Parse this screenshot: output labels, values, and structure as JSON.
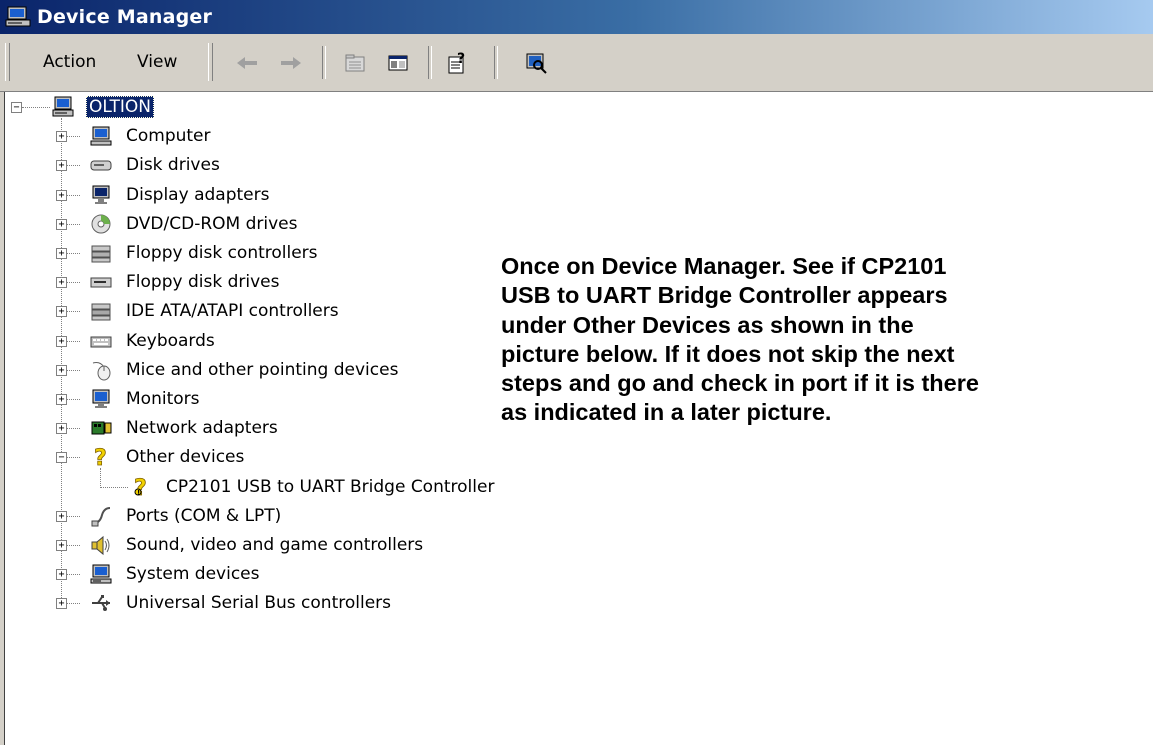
{
  "window": {
    "title": "Device Manager"
  },
  "menu": {
    "action": "Action",
    "view": "View"
  },
  "toolbar": {
    "buttons": [
      "back-icon",
      "forward-icon",
      "properties-icon",
      "show-hide-tree-icon",
      "help-icon",
      "scan-hardware-icon"
    ]
  },
  "tree": {
    "root": "OLTION",
    "categories": [
      "Computer",
      "Disk drives",
      "Display adapters",
      "DVD/CD-ROM drives",
      "Floppy disk controllers",
      "Floppy disk drives",
      "IDE ATA/ATAPI controllers",
      "Keyboards",
      "Mice and other pointing devices",
      "Monitors",
      "Network adapters",
      "Other devices",
      "Ports (COM & LPT)",
      "Sound, video and game controllers",
      "System devices",
      "Universal Serial Bus controllers"
    ],
    "other_devices_child": "CP2101 USB to UART Bridge Controller"
  },
  "annotation": {
    "lines": [
      "Once on Device Manager. See if CP2101",
      "USB to UART Bridge Controller appears",
      "under Other Devices as shown in the",
      "picture below. If it does not skip the next",
      "steps and go and check in port if it is there",
      "as indicated in a later picture."
    ]
  },
  "colors": {
    "titlebar_start": "#0a246a",
    "titlebar_end": "#a6caf0",
    "chrome": "#d4d0c8",
    "selection": "#0a246a"
  }
}
